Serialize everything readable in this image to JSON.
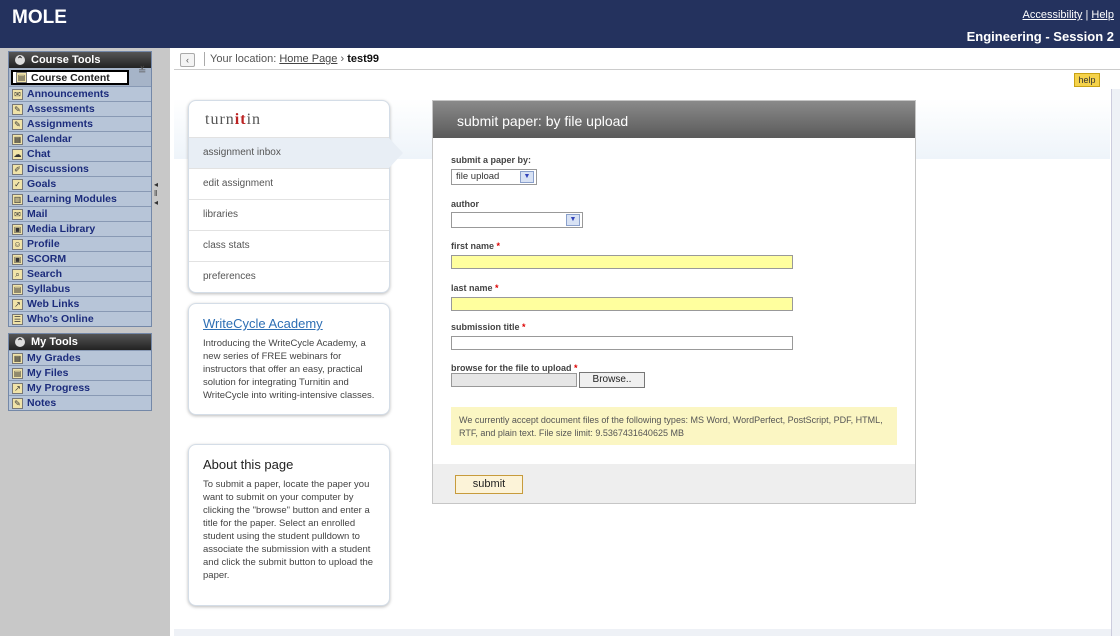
{
  "header": {
    "app_title": "MOLE",
    "accessibility_link": "Accessibility",
    "separator": "|",
    "help_link": "Help",
    "session_title": "Engineering - Session 2"
  },
  "sidebar": {
    "course_tools_title": "Course Tools",
    "course_tools": [
      "Course Content",
      "Announcements",
      "Assessments",
      "Assignments",
      "Calendar",
      "Chat",
      "Discussions",
      "Goals",
      "Learning Modules",
      "Mail",
      "Media Library",
      "Profile",
      "SCORM",
      "Search",
      "Syllabus",
      "Web Links",
      "Who's Online"
    ],
    "my_tools_title": "My Tools",
    "my_tools": [
      "My Grades",
      "My Files",
      "My Progress",
      "Notes"
    ]
  },
  "breadcrumb": {
    "prefix": "Your location:",
    "home_link": "Home Page",
    "separator": "›",
    "current": "test99"
  },
  "help_button": "help",
  "turnitin": {
    "logo_pre": "turn",
    "logo_it": "it",
    "logo_post": "in",
    "nav": [
      "assignment inbox",
      "edit assignment",
      "libraries",
      "class stats",
      "preferences"
    ]
  },
  "writecycle": {
    "title": "WriteCycle Academy",
    "text": "Introducing the WriteCycle Academy, a new series of FREE webinars for instructors that offer an easy, practical solution for integrating Turnitin and WriteCycle into writing-intensive classes."
  },
  "about": {
    "title": "About this page",
    "text": "To submit a paper, locate the paper you want to submit on your computer by clicking the \"browse\" button and enter a title for the paper. Select an enrolled student using the student pulldown to associate the submission with a student and click the submit button to upload the paper."
  },
  "form": {
    "title": "submit paper: by file upload",
    "submit_by_label": "submit a paper by:",
    "submit_by_value": "file upload",
    "author_label": "author",
    "author_value": "",
    "first_name_label": "first name",
    "last_name_label": "last name",
    "submission_title_label": "submission title",
    "file_label": "browse for the file to upload",
    "required_mark": "*",
    "browse_button": "Browse..",
    "note": "We currently accept document files of the following types: MS Word, WordPerfect, PostScript, PDF, HTML, RTF, and plain text. File size limit: 9.5367431640625 MB",
    "submit_button": "submit"
  }
}
